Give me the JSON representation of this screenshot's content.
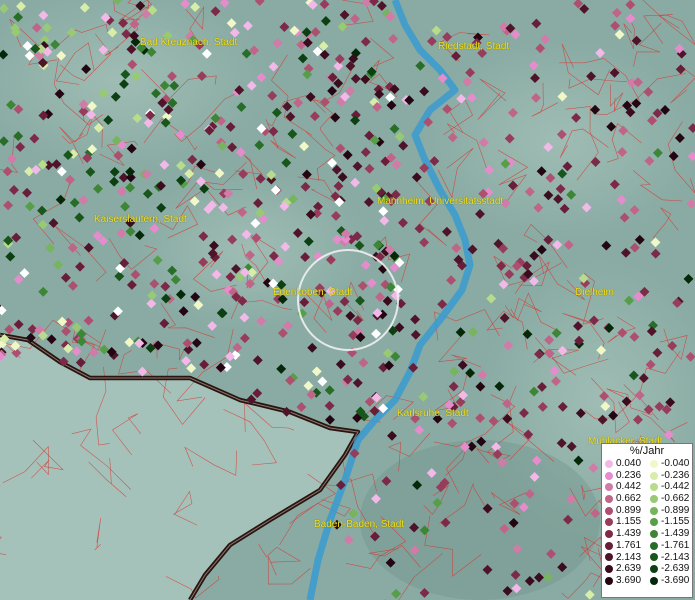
{
  "legend": {
    "title": "%/Jahr",
    "positive": [
      {
        "value": "0.040",
        "color": "#f2b8e8"
      },
      {
        "value": "0.236",
        "color": "#e58ccc"
      },
      {
        "value": "0.442",
        "color": "#d27aa8"
      },
      {
        "value": "0.662",
        "color": "#c06488"
      },
      {
        "value": "0.899",
        "color": "#ad5070"
      },
      {
        "value": "1.155",
        "color": "#973c5a"
      },
      {
        "value": "1.439",
        "color": "#7d2a48"
      },
      {
        "value": "1.761",
        "color": "#681e38"
      },
      {
        "value": "2.143",
        "color": "#50142a"
      },
      {
        "value": "2.639",
        "color": "#3a0c1e"
      },
      {
        "value": "3.690",
        "color": "#240612"
      }
    ],
    "negative": [
      {
        "value": "-0.040",
        "color": "#f0f8c8"
      },
      {
        "value": "-0.236",
        "color": "#d8eea8"
      },
      {
        "value": "-0.442",
        "color": "#b8dc8c"
      },
      {
        "value": "-0.662",
        "color": "#98ca74"
      },
      {
        "value": "-0.899",
        "color": "#76b45e"
      },
      {
        "value": "-1.155",
        "color": "#579e48"
      },
      {
        "value": "-1.439",
        "color": "#3c8636"
      },
      {
        "value": "-1.761",
        "color": "#286e28"
      },
      {
        "value": "-2.143",
        "color": "#18561c"
      },
      {
        "value": "-2.639",
        "color": "#0c4012"
      },
      {
        "value": "-3.690",
        "color": "#042808"
      }
    ]
  },
  "cities": [
    "Bad Kreuznach, Stadt",
    "Riedstadt, Stadt",
    "Kaiserslautern, Stadt",
    "Mannheim, Universitätsstadt",
    "Edenkoben, Stadt",
    "Dielheim",
    "Karlsruhe, Stadt",
    "Mühlacker, Stadt",
    "Baden-Baden, Stadt"
  ]
}
